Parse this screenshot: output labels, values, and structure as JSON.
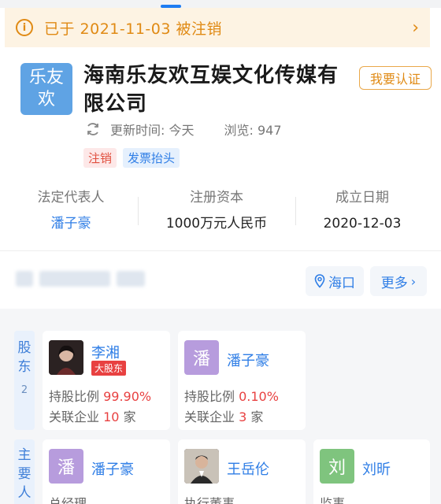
{
  "notice": {
    "text": "已于 2021-11-03 被注销",
    "chevron": "›"
  },
  "company": {
    "logo_text": "乐友欢",
    "name": "海南乐友欢互娱文化传媒有限公司",
    "claim_label": "我要认证",
    "update_label": "更新时间: 今天",
    "views_label": "浏览: 947",
    "tags": [
      "注销",
      "发票抬头"
    ]
  },
  "stats": [
    {
      "label": "法定代表人",
      "value": "潘子豪"
    },
    {
      "label": "注册资本",
      "value": "1000万元人民币"
    },
    {
      "label": "成立日期",
      "value": "2020-12-03"
    }
  ],
  "address": {
    "location_label": "海口",
    "more_label": "更多"
  },
  "shareholders": {
    "tab_label": "股东",
    "count": "2",
    "items": [
      {
        "name": "李湘",
        "badge": "大股东",
        "ratio_label": "持股比例",
        "ratio": "99.90%",
        "related_label": "关联企业",
        "related_count": "10",
        "related_unit": "家"
      },
      {
        "name": "潘子豪",
        "avatar_char": "潘",
        "ratio_label": "持股比例",
        "ratio": "0.10%",
        "related_label": "关联企业",
        "related_count": "3",
        "related_unit": "家"
      }
    ]
  },
  "key_people": {
    "tab_label": "主要人员",
    "items": [
      {
        "name": "潘子豪",
        "avatar_char": "潘",
        "role": "总经理"
      },
      {
        "name": "王岳伦",
        "role": "执行董事"
      },
      {
        "name": "刘昕",
        "avatar_char": "刘",
        "role": "监事"
      }
    ]
  },
  "colors": {
    "accent": "#2f7ee6",
    "warning": "#e08a14",
    "danger": "#e84141"
  },
  "icons": {
    "notice": "info-icon",
    "update": "refresh-icon",
    "location": "location-pin-icon"
  }
}
